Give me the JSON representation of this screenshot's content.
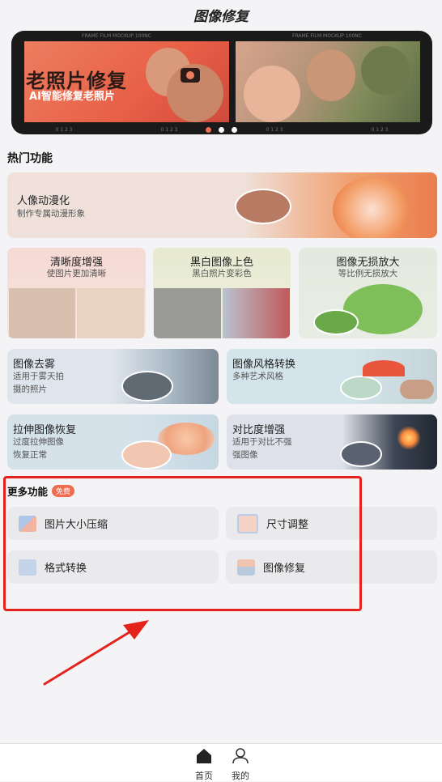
{
  "header": {
    "title": "图像修复"
  },
  "banner": {
    "title": "老照片修复",
    "subtitle": "AI智能修复老照片",
    "strip_text": "FRAME FILM MOCKUP 100NC",
    "slide_count": 3,
    "active_slide": 1
  },
  "hot": {
    "title": "热门功能",
    "cards": [
      {
        "title": "人像动漫化",
        "subtitle": "制作专属动漫形象"
      },
      {
        "title": "清晰度增强",
        "subtitle": "使图片更加清晰"
      },
      {
        "title": "黑白图像上色",
        "subtitle": "黑白照片变彩色"
      },
      {
        "title": "图像无损放大",
        "subtitle": "等比例无损放大"
      },
      {
        "title": "图像去雾",
        "subtitle1": "适用于雾天拍",
        "subtitle2": "摄的照片"
      },
      {
        "title": "图像风格转换",
        "subtitle": "多种艺术风格"
      },
      {
        "title": "拉伸图像恢复",
        "subtitle1": "过度拉伸图像",
        "subtitle2": "恢复正常"
      },
      {
        "title": "对比度增强",
        "subtitle1": "适用于对比不强",
        "subtitle2": "强图像"
      }
    ]
  },
  "more": {
    "title": "更多功能",
    "badge": "免费",
    "items": [
      {
        "label": "图片大小压缩",
        "icon": "compress-icon"
      },
      {
        "label": "尺寸调整",
        "icon": "resize-icon"
      },
      {
        "label": "格式转换",
        "icon": "format-icon"
      },
      {
        "label": "图像修复",
        "icon": "repair-icon"
      }
    ]
  },
  "tabbar": {
    "items": [
      {
        "label": "首页",
        "icon": "home-icon",
        "active": true
      },
      {
        "label": "我的",
        "icon": "user-icon",
        "active": false
      }
    ]
  },
  "colors": {
    "accent": "#ef6c50",
    "annotation": "#e3231c"
  }
}
